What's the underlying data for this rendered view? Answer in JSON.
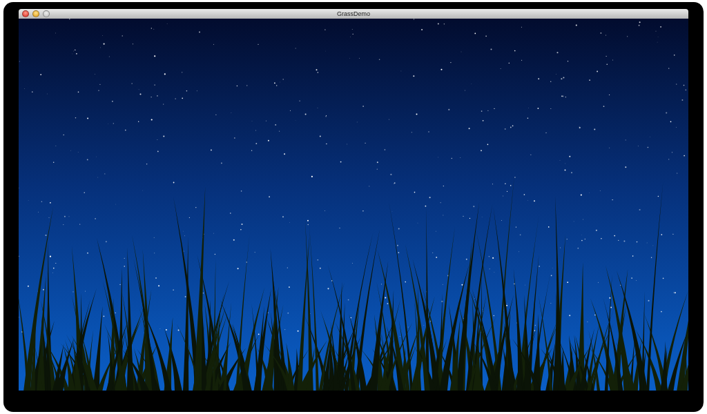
{
  "window": {
    "title": "GrassDemo",
    "controls": [
      {
        "kind": "close",
        "disabled": false
      },
      {
        "kind": "minimize",
        "disabled": false
      },
      {
        "kind": "zoom",
        "disabled": true
      }
    ]
  }
}
